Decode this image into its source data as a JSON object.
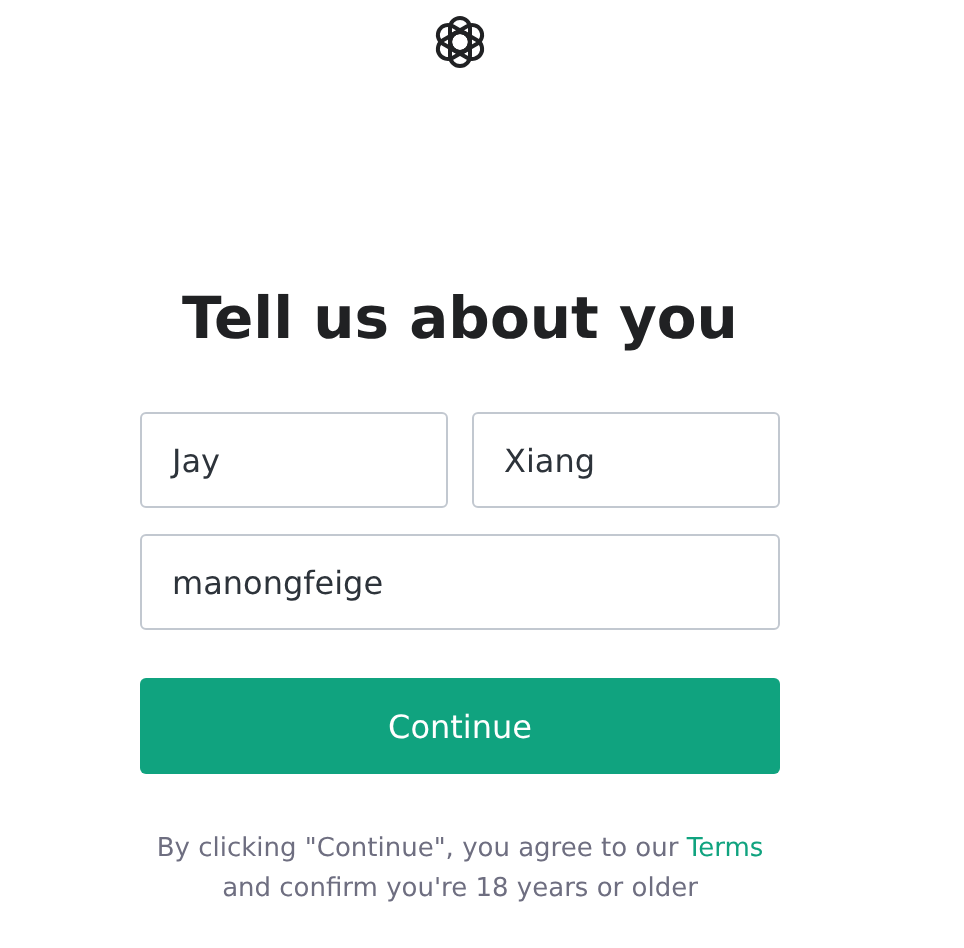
{
  "heading": "Tell us about you",
  "fields": [
    {
      "kind": "first_name",
      "value": "Jay"
    },
    {
      "kind": "last_name",
      "value": "Xiang"
    },
    {
      "kind": "username",
      "value": "manongfeige"
    }
  ],
  "continue_button": "Continue",
  "legal": {
    "before": "By clicking \"Continue\", you agree to our ",
    "link": "Terms",
    "after": "and confirm you're 18 years or older"
  }
}
